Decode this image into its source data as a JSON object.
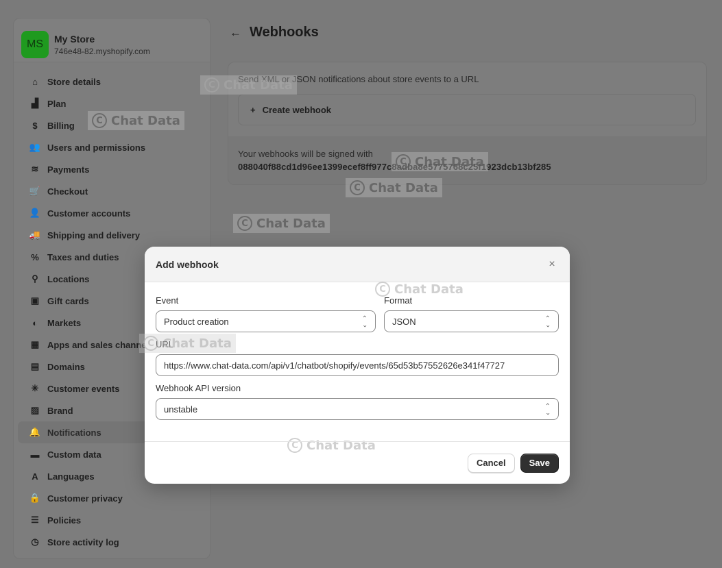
{
  "store": {
    "initials": "MS",
    "name": "My Store",
    "domain": "746e48-82.myshopify.com"
  },
  "sidebar": {
    "items": [
      {
        "label": "Store details",
        "icon": "store-icon",
        "glyph": "⌂"
      },
      {
        "label": "Plan",
        "icon": "plan-icon",
        "glyph": "▟"
      },
      {
        "label": "Billing",
        "icon": "billing-icon",
        "glyph": "$"
      },
      {
        "label": "Users and permissions",
        "icon": "users-icon",
        "glyph": "👥"
      },
      {
        "label": "Payments",
        "icon": "payments-icon",
        "glyph": "≋"
      },
      {
        "label": "Checkout",
        "icon": "cart-icon",
        "glyph": "🛒"
      },
      {
        "label": "Customer accounts",
        "icon": "person-icon",
        "glyph": "👤"
      },
      {
        "label": "Shipping and delivery",
        "icon": "truck-icon",
        "glyph": "🚚"
      },
      {
        "label": "Taxes and duties",
        "icon": "tax-bag-icon",
        "glyph": "%"
      },
      {
        "label": "Locations",
        "icon": "location-pin-icon",
        "glyph": "⚲"
      },
      {
        "label": "Gift cards",
        "icon": "gift-card-icon",
        "glyph": "▣"
      },
      {
        "label": "Markets",
        "icon": "globe-icon",
        "glyph": "◐"
      },
      {
        "label": "Apps and sales channels",
        "icon": "apps-icon",
        "glyph": "▦"
      },
      {
        "label": "Domains",
        "icon": "domains-icon",
        "glyph": "▤"
      },
      {
        "label": "Customer events",
        "icon": "cursor-click-icon",
        "glyph": "✳"
      },
      {
        "label": "Brand",
        "icon": "brand-icon",
        "glyph": "▨"
      },
      {
        "label": "Notifications",
        "icon": "bell-icon",
        "glyph": "🔔",
        "active": true
      },
      {
        "label": "Custom data",
        "icon": "custom-data-icon",
        "glyph": "▬"
      },
      {
        "label": "Languages",
        "icon": "languages-icon",
        "glyph": "A"
      },
      {
        "label": "Customer privacy",
        "icon": "lock-icon",
        "glyph": "🔒"
      },
      {
        "label": "Policies",
        "icon": "policies-icon",
        "glyph": "☰"
      },
      {
        "label": "Store activity log",
        "icon": "activity-log-icon",
        "glyph": "◷"
      }
    ]
  },
  "page": {
    "back_glyph": "←",
    "title": "Webhooks",
    "description": "Send XML or JSON notifications about store events to a URL",
    "create_label": "Create webhook",
    "create_glyph": "+",
    "signed_label": "Your webhooks will be signed with",
    "signing_key": "088040f88cd1d96ee1399ecef8ff977c8adba8e5775768c25f1923dcb13bf285"
  },
  "watermark": {
    "text": "Chat Data",
    "glyph": "C"
  },
  "modal": {
    "title": "Add webhook",
    "close_glyph": "×",
    "event": {
      "label": "Event",
      "value": "Product creation"
    },
    "format": {
      "label": "Format",
      "value": "JSON"
    },
    "url": {
      "label": "URL",
      "value": "https://www.chat-data.com/api/v1/chatbot/shopify/events/65d53b57552626e341f47727"
    },
    "api_version": {
      "label": "Webhook API version",
      "value": "unstable"
    },
    "cancel_label": "Cancel",
    "save_label": "Save"
  },
  "colors": {
    "backdrop": "#7a7a7a",
    "avatar": "#1f9a1f",
    "primary_button": "#303030"
  }
}
